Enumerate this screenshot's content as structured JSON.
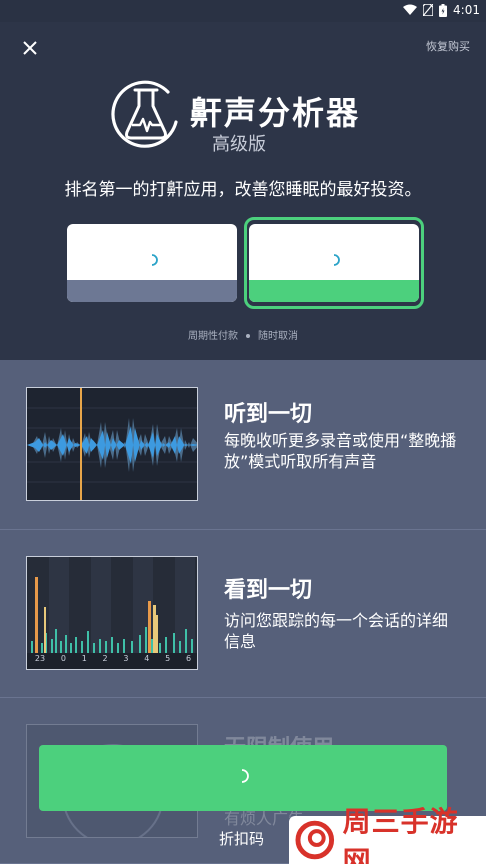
{
  "status_bar": {
    "time": "4:01"
  },
  "header": {
    "restore_label": "恢复购买",
    "app_title": "鼾声分析器",
    "app_subtitle": "高级版",
    "tagline": "排名第一的打鼾应用，改善您睡眠的最好投资。",
    "billing_left": "周期性付款",
    "billing_right": "随时取消"
  },
  "plans": [
    {
      "selected": false
    },
    {
      "selected": true
    }
  ],
  "features": [
    {
      "title": "听到一切",
      "desc": "每晚收听更多录音或使用“整晚播放”模式听取所有声音"
    },
    {
      "title": "看到一切",
      "desc": "访问您跟踪的每一个会话的详细信息"
    },
    {
      "title": "无限制使用",
      "desc": "有烦人广告"
    }
  ],
  "chart_thumb": {
    "tick_labels": [
      "23",
      "0",
      "1",
      "2",
      "3",
      "4",
      "5",
      "6"
    ]
  },
  "cta": {
    "discount_label": "折扣码"
  },
  "watermark": {
    "text": "周三手游网"
  },
  "colors": {
    "accent": "#4cd07d",
    "header_bg": "#2d3548",
    "body_bg": "#56607a",
    "plan_gray": "#6d7894"
  }
}
